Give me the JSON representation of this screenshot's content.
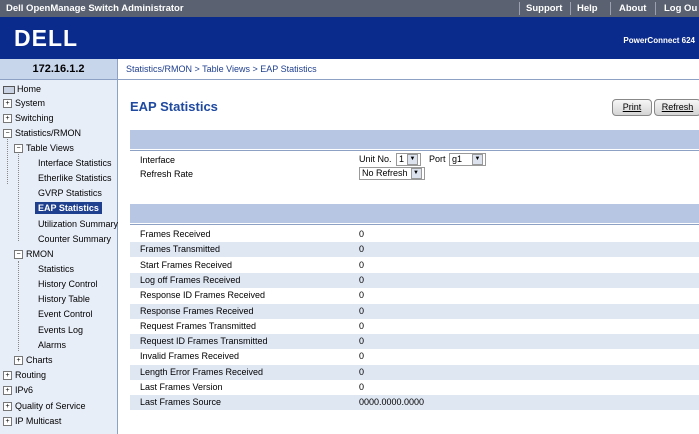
{
  "topbar": {
    "title": "Dell OpenManage Switch Administrator",
    "links": [
      "Support",
      "Help",
      "About",
      "Log Ou"
    ]
  },
  "banner": {
    "logo": "DELL",
    "model": "PowerConnect 624"
  },
  "ip": "172.16.1.2",
  "breadcrumb": "Statistics/RMON > Table Views > EAP Statistics",
  "nav": {
    "home": "Home",
    "system": "System",
    "switching": "Switching",
    "statistics_rmon": "Statistics/RMON",
    "table_views": "Table Views",
    "interface_statistics": "Interface Statistics",
    "etherlike_statistics": "Etherlike Statistics",
    "gvrp_statistics": "GVRP Statistics",
    "eap_statistics": "EAP Statistics",
    "utilization_summary": "Utilization Summary",
    "counter_summary": "Counter Summary",
    "rmon": "RMON",
    "rmon_statistics": "Statistics",
    "history_control": "History Control",
    "history_table": "History Table",
    "event_control": "Event Control",
    "events_log": "Events Log",
    "alarms": "Alarms",
    "charts": "Charts",
    "routing": "Routing",
    "ipv6": "IPv6",
    "qos": "Quality of Service",
    "ip_multicast": "IP Multicast"
  },
  "page": {
    "title": "EAP Statistics",
    "print": "Print",
    "refresh": "Refresh"
  },
  "form": {
    "interface_label": "Interface",
    "unit_label": "Unit No.",
    "unit_value": "1",
    "port_label": "Port",
    "port_value": "g1",
    "refresh_label": "Refresh Rate",
    "refresh_value": "No Refresh"
  },
  "stats": [
    {
      "label": "Frames Received",
      "value": "0"
    },
    {
      "label": "Frames Transmitted",
      "value": "0"
    },
    {
      "label": "Start Frames Received",
      "value": "0"
    },
    {
      "label": "Log off Frames Received",
      "value": "0"
    },
    {
      "label": "Response ID Frames Received",
      "value": "0"
    },
    {
      "label": "Response Frames Received",
      "value": "0"
    },
    {
      "label": "Request Frames Transmitted",
      "value": "0"
    },
    {
      "label": "Request ID Frames Transmitted",
      "value": "0"
    },
    {
      "label": "Invalid Frames Received",
      "value": "0"
    },
    {
      "label": "Length Error Frames Received",
      "value": "0"
    },
    {
      "label": "Last Frames Version",
      "value": "0"
    },
    {
      "label": "Last Frames Source",
      "value": "0000.0000.0000"
    }
  ]
}
